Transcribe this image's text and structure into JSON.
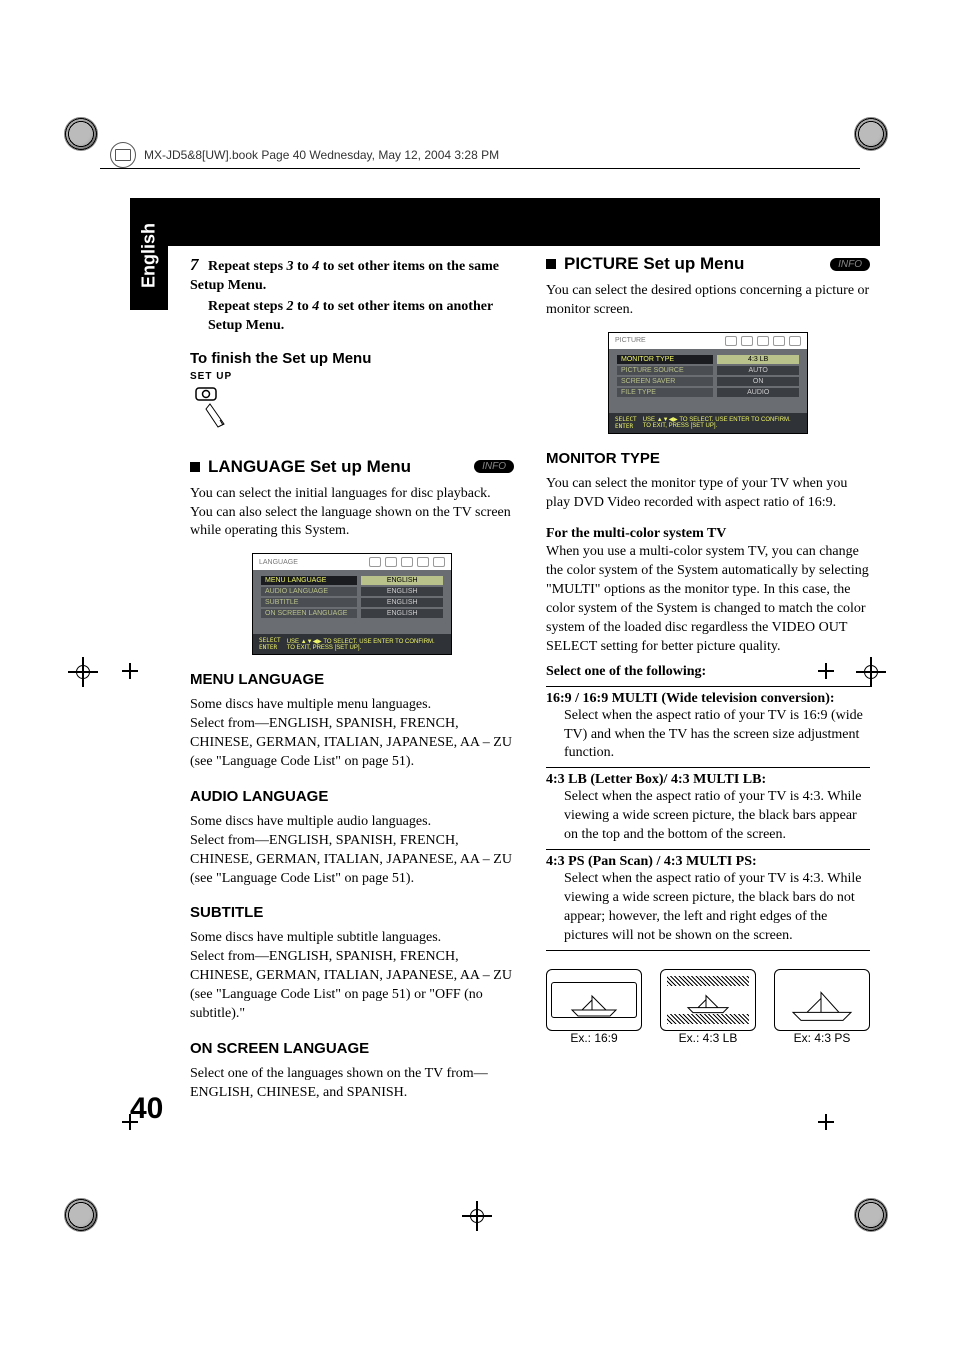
{
  "header_line": "MX-JD5&8[UW].book  Page 40  Wednesday, May 12, 2004  3:28 PM",
  "lang_tab": "English",
  "page_number": "40",
  "info_badge": "INFO",
  "left": {
    "step": {
      "num": "7",
      "line1a": "Repeat steps ",
      "line1b": "3",
      "line1c": " to ",
      "line1d": "4",
      "line1e": " to set other items on the same Setup Menu.",
      "line2a": "Repeat steps ",
      "line2b": "2",
      "line2c": " to ",
      "line2d": "4",
      "line2e": " to set other items on another Setup Menu."
    },
    "finish_h": "To finish the Set up Menu",
    "setup_label": "SET UP",
    "lang_section": "LANGUAGE Set up Menu",
    "lang_intro": "You can select the initial languages for disc playback. You can also select the language shown on the TV screen while operating this System.",
    "osd": {
      "title": "LANGUAGE",
      "rows": [
        {
          "l": "MENU LANGUAGE",
          "r": "ENGLISH",
          "active": true
        },
        {
          "l": "AUDIO LANGUAGE",
          "r": "ENGLISH"
        },
        {
          "l": "SUBTITLE",
          "r": "ENGLISH"
        },
        {
          "l": "ON SCREEN LANGUAGE",
          "r": "ENGLISH"
        }
      ],
      "foot_l": "SELECT\nENTER",
      "foot_r": "USE ▲▼◀▶ TO SELECT.  USE ENTER TO CONFIRM.\nTO EXIT, PRESS [SET UP]."
    },
    "menu_h": "MENU LANGUAGE",
    "menu_p1": "Some discs have multiple menu languages.",
    "menu_p2": "Select from—ENGLISH, SPANISH, FRENCH, CHINESE, GERMAN, ITALIAN, JAPANESE, AA – ZU (see \"Language Code List\" on page 51).",
    "audio_h": "AUDIO LANGUAGE",
    "audio_p1": "Some discs have multiple audio languages.",
    "audio_p2": "Select from—ENGLISH, SPANISH, FRENCH, CHINESE, GERMAN, ITALIAN, JAPANESE, AA – ZU (see \"Language Code List\" on page 51).",
    "sub_h": "SUBTITLE",
    "sub_p1": "Some discs have multiple subtitle languages.",
    "sub_p2": "Select from—ENGLISH, SPANISH, FRENCH, CHINESE, GERMAN, ITALIAN, JAPANESE, AA – ZU (see \"Language Code List\" on page 51) or \"OFF (no subtitle).\"",
    "osl_h": "ON SCREEN LANGUAGE",
    "osl_p": "Select one of the languages shown on the TV from—ENGLISH, CHINESE, and SPANISH."
  },
  "right": {
    "pic_section": "PICTURE Set up Menu",
    "pic_intro": "You can select the desired options concerning a picture or monitor screen.",
    "osd": {
      "title": "PICTURE",
      "rows": [
        {
          "l": "MONITOR TYPE",
          "r": "4:3 LB",
          "active": true
        },
        {
          "l": "PICTURE SOURCE",
          "r": "AUTO"
        },
        {
          "l": "SCREEN SAVER",
          "r": "ON"
        },
        {
          "l": "FILE TYPE",
          "r": "AUDIO"
        }
      ],
      "foot_l": "SELECT\nENTER",
      "foot_r": "USE ▲▼◀▶ TO SELECT.  USE ENTER TO CONFIRM.\nTO EXIT, PRESS [SET UP]."
    },
    "mon_h": "MONITOR TYPE",
    "mon_p": "You can select the monitor type of your TV when you play DVD Video recorded with aspect ratio of 16:9.",
    "multi_h": "For the multi-color system TV",
    "multi_p": "When you use a multi-color system TV, you can change the color system of the System automatically by selecting \"MULTI\" options as the monitor type. In this case, the color system of the System is changed to match the color system of the loaded disc regardless the VIDEO OUT SELECT setting for better picture quality.",
    "select_h": "Select one of the following:",
    "opt1_h": "16:9 / 16:9 MULTI (Wide television conversion):",
    "opt1_p": "Select when the aspect ratio of your TV is 16:9 (wide TV) and when the TV has the screen size adjustment function.",
    "opt2_h": "4:3 LB (Letter Box)/ 4:3 MULTI LB:",
    "opt2_p": "Select when the aspect ratio of your TV is 4:3. While viewing a wide screen picture, the black bars appear on the top and the bottom of the screen.",
    "opt3_h": "4:3 PS (Pan Scan) / 4:3 MULTI PS:",
    "opt3_p": "Select when the aspect ratio of your TV is 4:3. While viewing a wide screen picture, the black bars do not appear; however, the left and right edges of the pictures will not be shown on the screen.",
    "ex1": "Ex.: 16:9",
    "ex2": "Ex.: 4:3 LB",
    "ex3": "Ex: 4:3 PS"
  }
}
